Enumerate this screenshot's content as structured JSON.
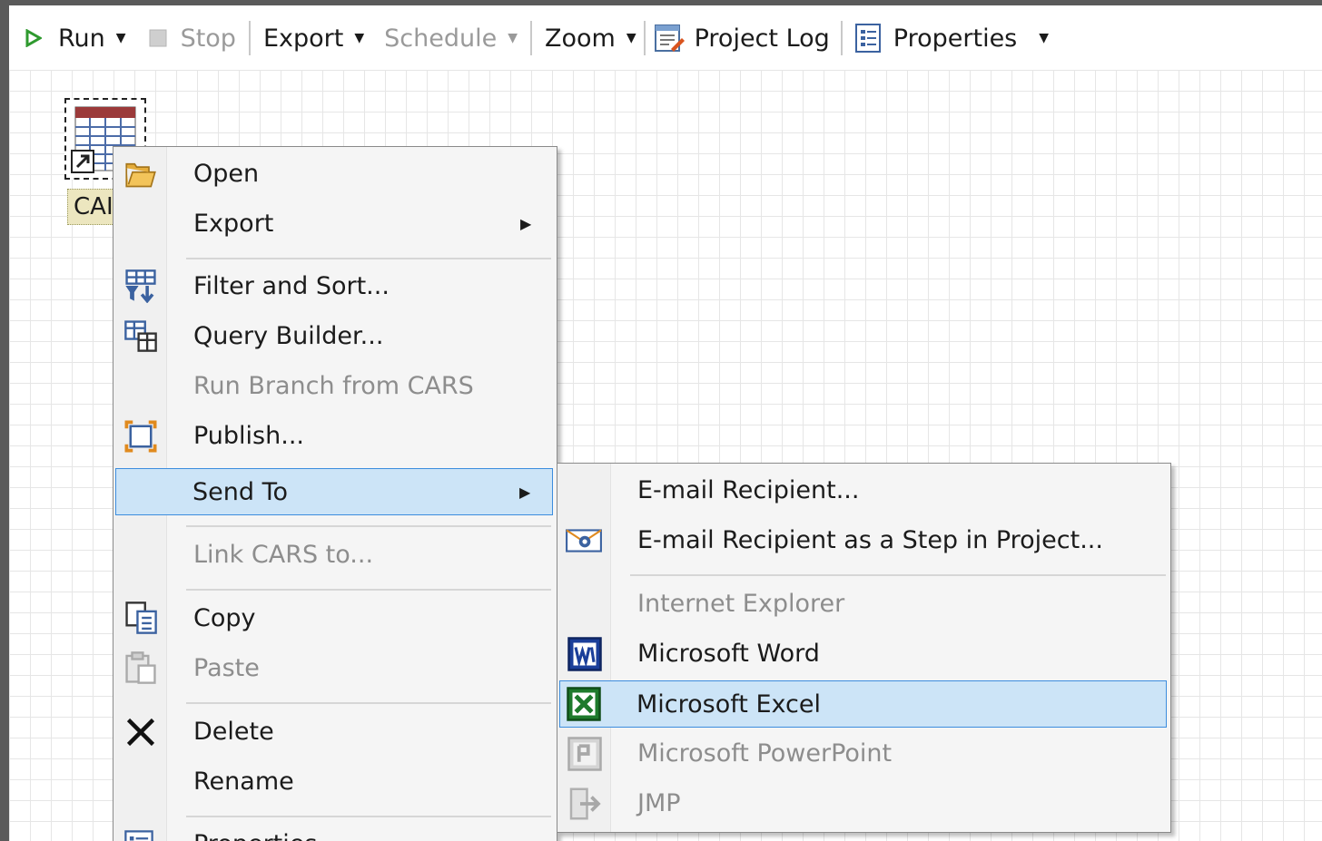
{
  "toolbar": {
    "run": "Run",
    "stop": "Stop",
    "export": "Export",
    "schedule": "Schedule",
    "zoom": "Zoom",
    "project_log": "Project Log",
    "properties": "Properties"
  },
  "node": {
    "label": "CAI"
  },
  "context_menu": {
    "open": "Open",
    "export": "Export",
    "filter_sort": "Filter and Sort...",
    "query_builder": "Query Builder...",
    "run_branch": "Run Branch from CARS",
    "publish": "Publish...",
    "send_to": "Send To",
    "link": "Link CARS to...",
    "copy": "Copy",
    "paste": "Paste",
    "delete": "Delete",
    "rename": "Rename",
    "properties": "Properties"
  },
  "send_to_menu": {
    "email": "E-mail Recipient...",
    "email_step": "E-mail Recipient as a Step in Project...",
    "ie": "Internet Explorer",
    "word": "Microsoft Word",
    "excel": "Microsoft Excel",
    "powerpoint": "Microsoft PowerPoint",
    "jmp": "JMP"
  },
  "colors": {
    "highlight_bg": "#cce4f7",
    "highlight_border": "#3c8dde",
    "disabled_text": "#8d8d8d"
  },
  "icons": {
    "run": "play-icon",
    "stop": "stop-icon",
    "project_log": "log-icon",
    "properties": "properties-icon",
    "open": "folder-open-icon",
    "filter": "filter-sort-icon",
    "query": "query-builder-icon",
    "publish": "publish-icon",
    "copy": "copy-icon",
    "paste": "paste-icon",
    "delete": "delete-x-icon",
    "email_step": "email-step-icon",
    "word": "word-icon",
    "excel": "excel-icon",
    "powerpoint": "powerpoint-icon",
    "jmp": "jmp-icon"
  }
}
